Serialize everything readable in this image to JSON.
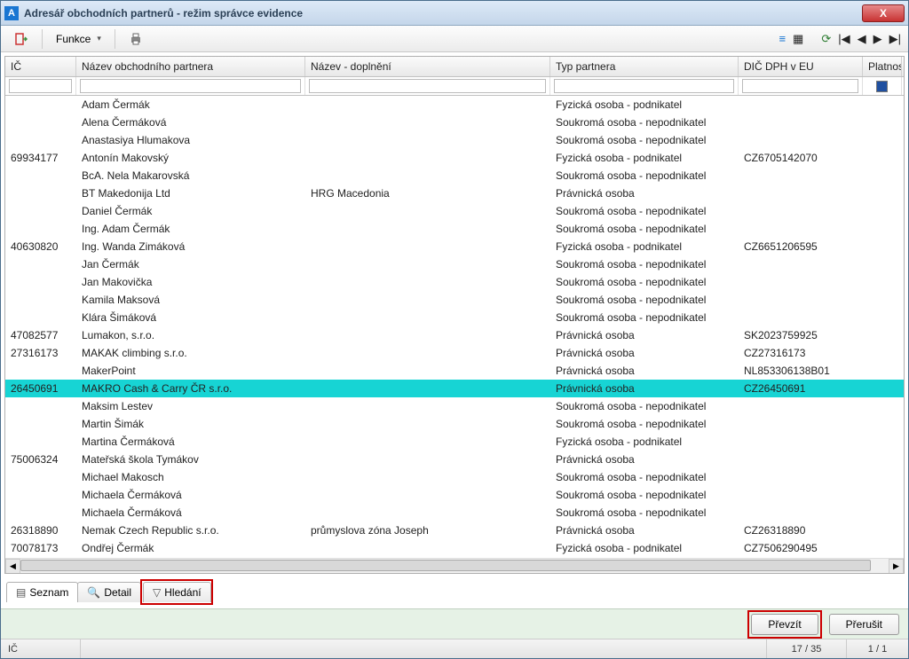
{
  "window": {
    "title": "Adresář obchodních partnerů - režim správce evidence",
    "close": "X"
  },
  "toolbar": {
    "funkce": "Funkce"
  },
  "columns": {
    "ic": "IČ",
    "name": "Název obchodního partnera",
    "dopl": "Název - doplnění",
    "typ": "Typ partnera",
    "dic": "DIČ DPH v EU",
    "plat": "Platnost"
  },
  "rows": [
    {
      "ic": "",
      "name": "Adam Čermák",
      "dopl": "",
      "typ": "Fyzická osoba - podnikatel",
      "dic": "",
      "selected": false
    },
    {
      "ic": "",
      "name": "Alena Čermáková",
      "dopl": "",
      "typ": "Soukromá osoba - nepodnikatel",
      "dic": "",
      "selected": false
    },
    {
      "ic": "",
      "name": "Anastasiya Hlumakova",
      "dopl": "",
      "typ": "Soukromá osoba - nepodnikatel",
      "dic": "",
      "selected": false
    },
    {
      "ic": "69934177",
      "name": "Antonín Makovský",
      "dopl": "",
      "typ": "Fyzická osoba - podnikatel",
      "dic": "CZ6705142070",
      "selected": false
    },
    {
      "ic": "",
      "name": "BcA. Nela Makarovská",
      "dopl": "",
      "typ": "Soukromá osoba - nepodnikatel",
      "dic": "",
      "selected": false
    },
    {
      "ic": "",
      "name": "BT Makedonija Ltd",
      "dopl": "HRG Macedonia",
      "typ": "Právnická osoba",
      "dic": "",
      "selected": false
    },
    {
      "ic": "",
      "name": "Daniel Čermák",
      "dopl": "",
      "typ": "Soukromá osoba - nepodnikatel",
      "dic": "",
      "selected": false
    },
    {
      "ic": "",
      "name": "Ing. Adam Čermák",
      "dopl": "",
      "typ": "Soukromá osoba - nepodnikatel",
      "dic": "",
      "selected": false
    },
    {
      "ic": "40630820",
      "name": "Ing. Wanda Zimáková",
      "dopl": "",
      "typ": "Fyzická osoba - podnikatel",
      "dic": "CZ6651206595",
      "selected": false
    },
    {
      "ic": "",
      "name": "Jan Čermák",
      "dopl": "",
      "typ": "Soukromá osoba - nepodnikatel",
      "dic": "",
      "selected": false
    },
    {
      "ic": "",
      "name": "Jan Makovička",
      "dopl": "",
      "typ": "Soukromá osoba - nepodnikatel",
      "dic": "",
      "selected": false
    },
    {
      "ic": "",
      "name": "Kamila Maksová",
      "dopl": "",
      "typ": "Soukromá osoba - nepodnikatel",
      "dic": "",
      "selected": false
    },
    {
      "ic": "",
      "name": "Klára Šimáková",
      "dopl": "",
      "typ": "Soukromá osoba - nepodnikatel",
      "dic": "",
      "selected": false
    },
    {
      "ic": "47082577",
      "name": "Lumakon, s.r.o.",
      "dopl": "",
      "typ": "Právnická osoba",
      "dic": "SK2023759925",
      "selected": false
    },
    {
      "ic": "27316173",
      "name": "MAKAK climbing s.r.o.",
      "dopl": "",
      "typ": "Právnická osoba",
      "dic": "CZ27316173",
      "selected": false
    },
    {
      "ic": "",
      "name": "MakerPoint",
      "dopl": "",
      "typ": "Právnická osoba",
      "dic": "NL853306138B01",
      "selected": false
    },
    {
      "ic": "26450691",
      "name": "MAKRO Cash & Carry ČR s.r.o.",
      "dopl": "",
      "typ": "Právnická osoba",
      "dic": "CZ26450691",
      "selected": true
    },
    {
      "ic": "",
      "name": "Maksim Lestev",
      "dopl": "",
      "typ": "Soukromá osoba - nepodnikatel",
      "dic": "",
      "selected": false
    },
    {
      "ic": "",
      "name": "Martin Šimák",
      "dopl": "",
      "typ": "Soukromá osoba - nepodnikatel",
      "dic": "",
      "selected": false
    },
    {
      "ic": "",
      "name": "Martina Čermáková",
      "dopl": "",
      "typ": "Fyzická osoba - podnikatel",
      "dic": "",
      "selected": false
    },
    {
      "ic": "75006324",
      "name": "Mateřská škola Tymákov",
      "dopl": "",
      "typ": "Právnická osoba",
      "dic": "",
      "selected": false
    },
    {
      "ic": "",
      "name": "Michael Makosch",
      "dopl": "",
      "typ": "Soukromá osoba - nepodnikatel",
      "dic": "",
      "selected": false
    },
    {
      "ic": "",
      "name": "Michaela Čermáková",
      "dopl": "",
      "typ": "Soukromá osoba - nepodnikatel",
      "dic": "",
      "selected": false
    },
    {
      "ic": "",
      "name": "Michaela Čermáková",
      "dopl": "",
      "typ": "Soukromá osoba - nepodnikatel",
      "dic": "",
      "selected": false
    },
    {
      "ic": "26318890",
      "name": "Nemak Czech Republic s.r.o.",
      "dopl": "průmyslova zóna Joseph",
      "typ": "Právnická osoba",
      "dic": "CZ26318890",
      "selected": false
    },
    {
      "ic": "70078173",
      "name": "Ondřej Čermák",
      "dopl": "",
      "typ": "Fyzická osoba - podnikatel",
      "dic": "CZ7506290495",
      "selected": false
    }
  ],
  "tabs": {
    "seznam": "Seznam",
    "detail": "Detail",
    "hledani": "Hledání"
  },
  "footer": {
    "prevzit": "Převzít",
    "prerusit": "Přerušit"
  },
  "status": {
    "left": "IČ",
    "count": "17 / 35",
    "page": "1 / 1"
  }
}
